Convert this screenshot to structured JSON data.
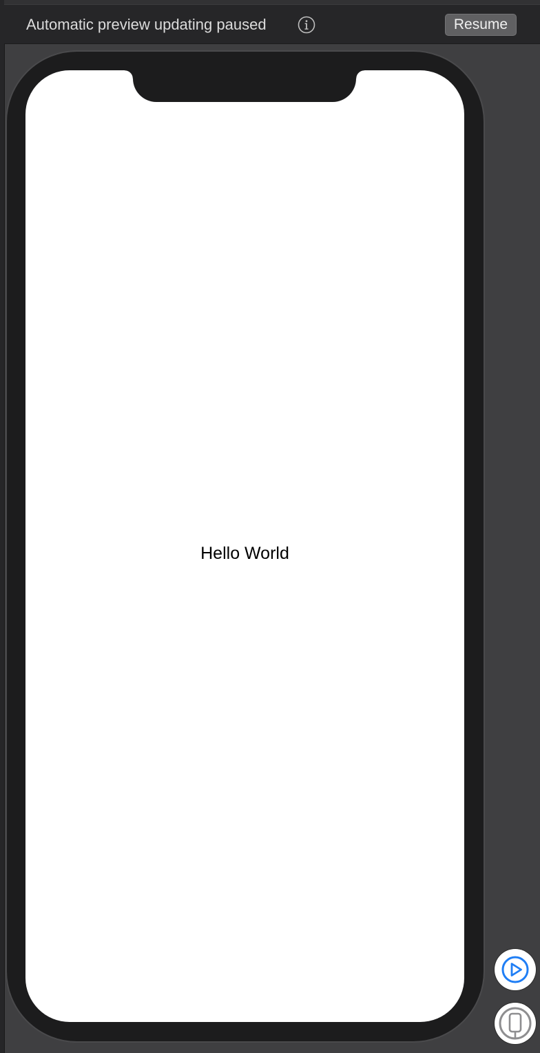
{
  "toolbar": {
    "status_text": "Automatic preview updating paused",
    "info_icon": "info-circle-icon",
    "resume_label": "Resume"
  },
  "preview": {
    "text": "Hello World"
  },
  "side_controls": {
    "live_preview_icon": "play-circle-icon",
    "device_icon": "iphone-icon"
  },
  "colors": {
    "toolbar_bg": "#262628",
    "canvas_bg": "#3f3f41",
    "device_frame": "#1c1c1d",
    "screen_bg": "#ffffff",
    "accent": "#1f7ef5",
    "resume_button_bg": "#606062"
  }
}
